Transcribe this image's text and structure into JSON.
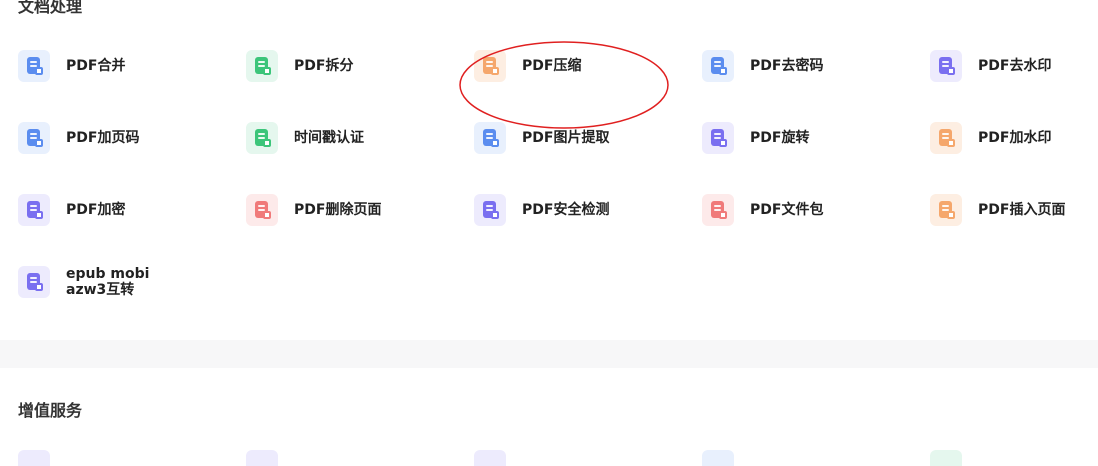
{
  "sections": {
    "doc_processing": {
      "title": "文档处理"
    },
    "value_added": {
      "title": "增值服务"
    }
  },
  "tools": [
    {
      "label": "PDF合并",
      "icon": "pdf-merge-icon",
      "color": "#5b8def",
      "bg": "#e8f0fd"
    },
    {
      "label": "PDF拆分",
      "icon": "pdf-split-icon",
      "color": "#3cc57a",
      "bg": "#e5f7ee"
    },
    {
      "label": "PDF压缩",
      "icon": "pdf-compress-icon",
      "color": "#f5a76c",
      "bg": "#fdeee2"
    },
    {
      "label": "PDF去密码",
      "icon": "pdf-remove-password-icon",
      "color": "#5b8def",
      "bg": "#e8f0fd"
    },
    {
      "label": "PDF去水印",
      "icon": "pdf-remove-watermark-icon",
      "color": "#7a6ff0",
      "bg": "#edebfd"
    },
    {
      "label": "PDF加页码",
      "icon": "pdf-add-page-number-icon",
      "color": "#5b8def",
      "bg": "#e8f0fd"
    },
    {
      "label": "时间戳认证",
      "icon": "timestamp-icon",
      "color": "#3cc57a",
      "bg": "#e5f7ee"
    },
    {
      "label": "PDF图片提取",
      "icon": "pdf-image-extract-icon",
      "color": "#5b8def",
      "bg": "#e8f0fd"
    },
    {
      "label": "PDF旋转",
      "icon": "pdf-rotate-icon",
      "color": "#7a6ff0",
      "bg": "#edebfd"
    },
    {
      "label": "PDF加水印",
      "icon": "pdf-add-watermark-icon",
      "color": "#f5a76c",
      "bg": "#fdeee2"
    },
    {
      "label": "PDF加密",
      "icon": "pdf-encrypt-icon",
      "color": "#7a6ff0",
      "bg": "#edebfd"
    },
    {
      "label": "PDF删除页面",
      "icon": "pdf-delete-page-icon",
      "color": "#f07a7a",
      "bg": "#fdeaea"
    },
    {
      "label": "PDF安全检测",
      "icon": "pdf-security-check-icon",
      "color": "#7a6ff0",
      "bg": "#edebfd"
    },
    {
      "label": "PDF文件包",
      "icon": "pdf-package-icon",
      "color": "#f07a7a",
      "bg": "#fdeaea"
    },
    {
      "label": "PDF插入页面",
      "icon": "pdf-insert-page-icon",
      "color": "#f5a76c",
      "bg": "#fdeee2"
    },
    {
      "label": "epub mobi\nazw3互转",
      "icon": "ebook-convert-icon",
      "color": "#7a6ff0",
      "bg": "#edebfd"
    }
  ],
  "value_added_icon_colors": [
    "#edebfd",
    "#edebfd",
    "#edebfd",
    "#e8f0fd",
    "#e5f7ee"
  ]
}
